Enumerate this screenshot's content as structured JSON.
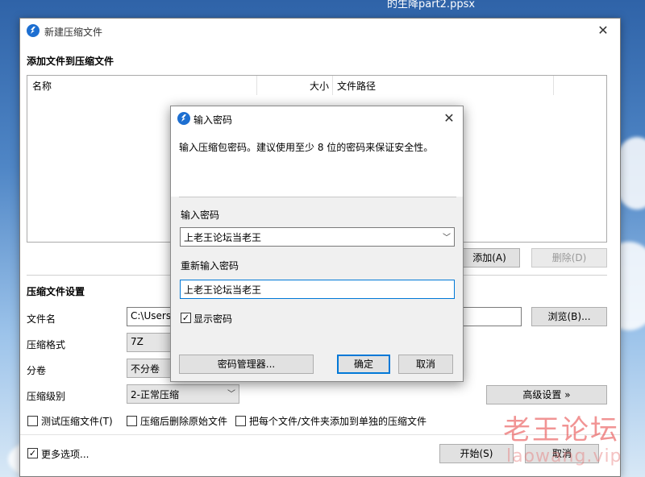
{
  "desktop": {
    "top_file": "的生降part2.ppsx"
  },
  "main": {
    "title": "新建压缩文件",
    "section_add": "添加文件到压缩文件",
    "columns": [
      "名称",
      "大小",
      "文件路径"
    ],
    "add_button": "添加(A)",
    "delete_button": "删除(D)",
    "section_settings": "压缩文件设置",
    "filename_label": "文件名",
    "filename_value": "C:\\Users\\",
    "browse_button": "浏览(B)...",
    "format_label": "压缩格式",
    "format_value": "7Z",
    "split_label": "分卷",
    "split_value": "不分卷",
    "level_label": "压缩级别",
    "level_value": "2-正常压缩",
    "advanced_button": "高级设置 »",
    "opt_test": "测试压缩文件(T)",
    "opt_delete": "压缩后删除原始文件",
    "opt_each": "把每个文件/文件夹添加到单独的压缩文件",
    "more_options": "更多选项...",
    "more_options_checked": true,
    "start_button": "开始(S)",
    "cancel_button": "取消"
  },
  "dialog": {
    "title": "输入密码",
    "description": "输入压缩包密码。建议使用至少 8 位的密码来保证安全性。",
    "password_label": "输入密码",
    "password_value": "上老王论坛当老王",
    "reenter_label": "重新输入密码",
    "reenter_value": "上老王论坛当老王",
    "show_password": "显示密码",
    "show_password_checked": true,
    "manager_button": "密码管理器...",
    "ok_button": "确定",
    "cancel_button": "取消"
  },
  "watermark": {
    "line1": "老王论坛",
    "line2": "laowang.vip"
  },
  "colors": {
    "accent": "#0078d7",
    "app_icon": "#1d6fd1"
  }
}
